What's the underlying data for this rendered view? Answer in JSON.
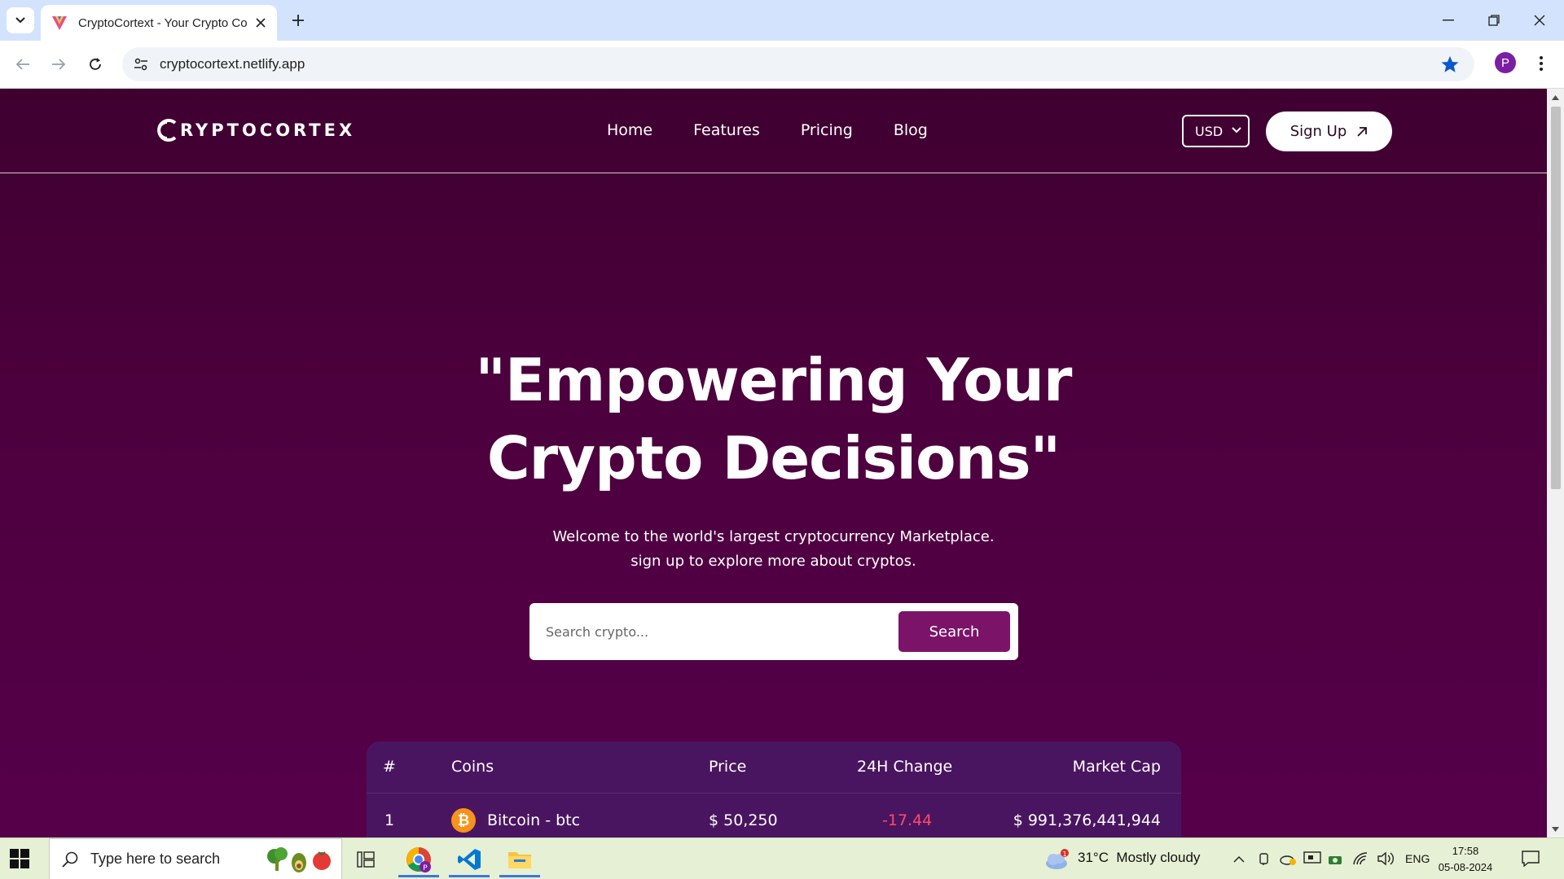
{
  "browser": {
    "tab_title": "CryptoCortext - Your Crypto Co",
    "url": "cryptocortext.netlify.app",
    "profile_initial": "P"
  },
  "site": {
    "logo_text": "RYPTOCORTEX",
    "nav": [
      "Home",
      "Features",
      "Pricing",
      "Blog"
    ],
    "currency": "USD",
    "signup_label": "Sign Up",
    "hero_line1": "\"Empowering Your",
    "hero_line2": "Crypto Decisions\"",
    "sub_line1": "Welcome to the world's largest cryptocurrency Marketplace.",
    "sub_line2": "sign up to explore more about cryptos.",
    "search_placeholder": "Search crypto...",
    "search_button": "Search",
    "table": {
      "headers": [
        "#",
        "Coins",
        "Price",
        "24H Change",
        "Market Cap"
      ],
      "rows": [
        {
          "rank": "1",
          "coin": "Bitcoin - btc",
          "price": "$ 50,250",
          "change": "-17.44",
          "market_cap": "$ 991,376,441,944"
        }
      ]
    },
    "colors": {
      "accent": "#7b1469",
      "background": "#4c003d",
      "negative": "#ff4a6a"
    }
  },
  "taskbar": {
    "search_placeholder": "Type here to search",
    "weather": "31°C  Mostly cloudy",
    "language": "ENG",
    "time": "17:58",
    "date": "05-08-2024",
    "weather_badge": "1"
  }
}
